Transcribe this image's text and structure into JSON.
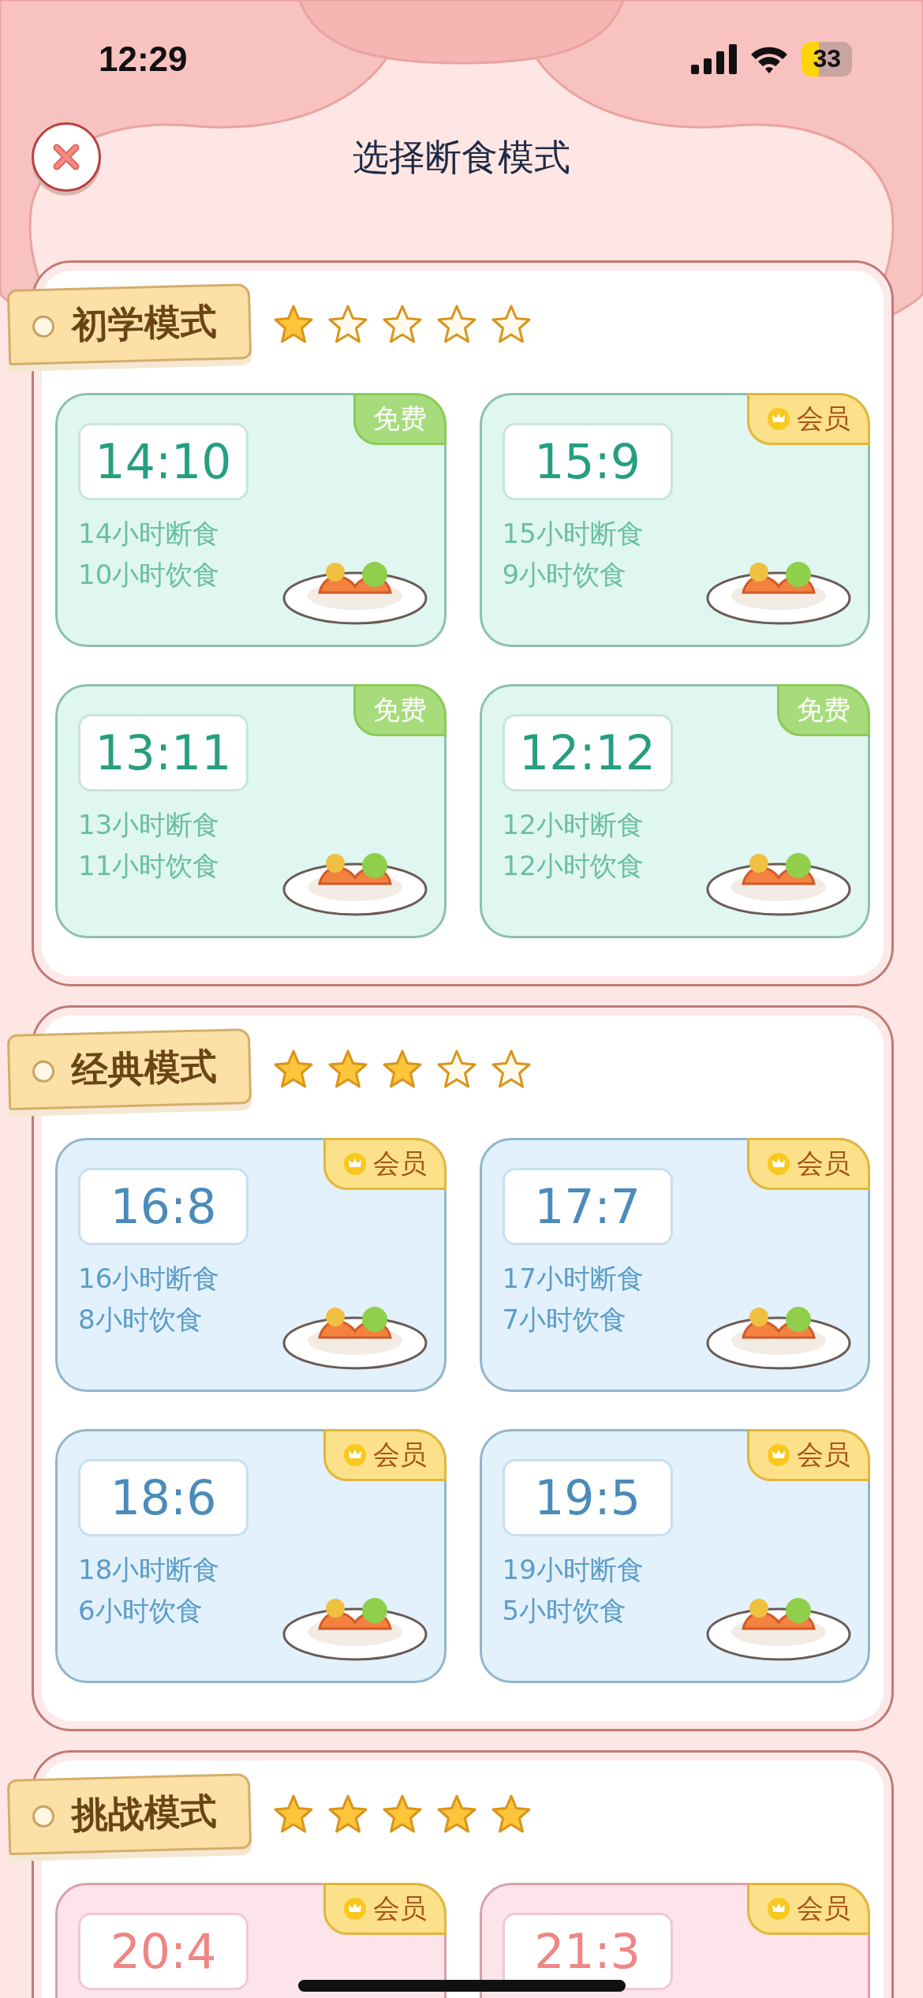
{
  "status_bar": {
    "time": "12:29",
    "battery": "33"
  },
  "header": {
    "title": "选择断食模式"
  },
  "sections": [
    {
      "title": "初学模式",
      "stars": 1,
      "kind": "green",
      "cards": [
        {
          "ratio": "14:10",
          "fasting": "14小时断食",
          "eating": "10小时饮食",
          "badge": {
            "kind": "free",
            "label": "免费"
          }
        },
        {
          "ratio": "15:9",
          "fasting": "15小时断食",
          "eating": "9小时饮食",
          "badge": {
            "kind": "member",
            "label": "会员"
          }
        },
        {
          "ratio": "13:11",
          "fasting": "13小时断食",
          "eating": "11小时饮食",
          "badge": {
            "kind": "free",
            "label": "免费"
          }
        },
        {
          "ratio": "12:12",
          "fasting": "12小时断食",
          "eating": "12小时饮食",
          "badge": {
            "kind": "free",
            "label": "免费"
          }
        }
      ]
    },
    {
      "title": "经典模式",
      "stars": 3,
      "kind": "blue",
      "cards": [
        {
          "ratio": "16:8",
          "fasting": "16小时断食",
          "eating": "8小时饮食",
          "badge": {
            "kind": "member",
            "label": "会员"
          }
        },
        {
          "ratio": "17:7",
          "fasting": "17小时断食",
          "eating": "7小时饮食",
          "badge": {
            "kind": "member",
            "label": "会员"
          }
        },
        {
          "ratio": "18:6",
          "fasting": "18小时断食",
          "eating": "6小时饮食",
          "badge": {
            "kind": "member",
            "label": "会员"
          }
        },
        {
          "ratio": "19:5",
          "fasting": "19小时断食",
          "eating": "5小时饮食",
          "badge": {
            "kind": "member",
            "label": "会员"
          }
        }
      ]
    },
    {
      "title": "挑战模式",
      "stars": 5,
      "kind": "pink",
      "cards": [
        {
          "ratio": "20:4",
          "badge": {
            "kind": "member",
            "label": "会员"
          }
        },
        {
          "ratio": "21:3",
          "badge": {
            "kind": "member",
            "label": "会员"
          }
        }
      ]
    }
  ]
}
